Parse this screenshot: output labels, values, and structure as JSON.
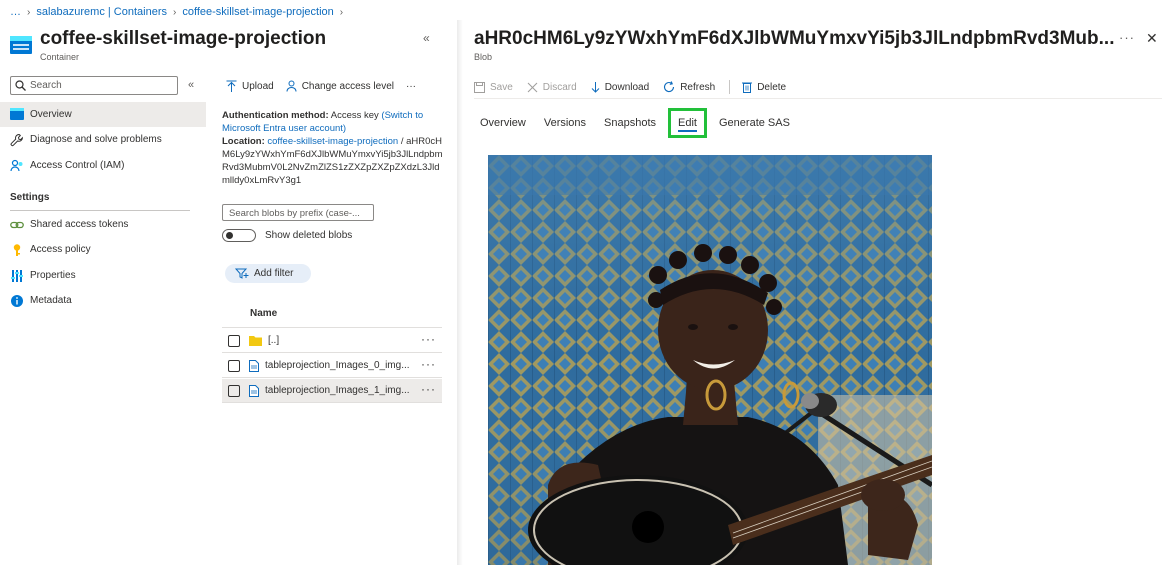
{
  "breadcrumb": {
    "ellipsis": "…",
    "items": [
      "salabazuremc | Containers",
      "coffee-skillset-image-projection"
    ]
  },
  "container": {
    "title": "coffee-skillset-image-projection",
    "subtitle": "Container"
  },
  "search": {
    "placeholder": "Search"
  },
  "nav": {
    "items": [
      {
        "label": "Overview",
        "icon": "container-icon",
        "selected": true
      },
      {
        "label": "Diagnose and solve problems",
        "icon": "wrench-icon"
      },
      {
        "label": "Access Control (IAM)",
        "icon": "people-icon"
      }
    ],
    "settings_heading": "Settings",
    "settings_items": [
      {
        "label": "Shared access tokens",
        "icon": "link-icon"
      },
      {
        "label": "Access policy",
        "icon": "key-icon"
      },
      {
        "label": "Properties",
        "icon": "properties-icon"
      },
      {
        "label": "Metadata",
        "icon": "info-icon"
      }
    ]
  },
  "middle": {
    "toolbar": {
      "upload": "Upload",
      "change_access": "Change access level",
      "more": "···"
    },
    "auth_label": "Authentication method:",
    "auth_value": "Access key",
    "auth_switch": "(Switch to Microsoft Entra user account)",
    "location_label": "Location:",
    "location_link": "coffee-skillset-image-projection",
    "location_sep": "/",
    "location_path": "aHR0cHM6Ly9zYWxhYmF6dXJlbWMuYmxvYi5jb3JlLndpbmRvd3MubmV0L2NvZmZlZS1zZXZpZXZpZXdzL3Jldmlldy0xLmRvY3g1",
    "prefix_placeholder": "Search blobs by prefix (case-...",
    "show_deleted": "Show deleted blobs",
    "show_deleted_on": false,
    "add_filter": "Add filter",
    "column_name": "Name",
    "rows": [
      {
        "name": "[..]",
        "type": "folder"
      },
      {
        "name": "tableprojection_Images_0_img...",
        "type": "file"
      },
      {
        "name": "tableprojection_Images_1_img...",
        "type": "file"
      }
    ],
    "row_more": "···"
  },
  "blade": {
    "title": "aHR0cHM6Ly9zYWxhYmF6dXJlbWMuYmxvYi5jb3JlLndpbmRvd3Mub...",
    "subtitle": "Blob",
    "more": "···",
    "close": "✕",
    "commands": {
      "save": "Save",
      "discard": "Discard",
      "download": "Download",
      "refresh": "Refresh",
      "delete": "Delete"
    },
    "tabs": [
      "Overview",
      "Versions",
      "Snapshots",
      "Edit",
      "Generate SAS"
    ],
    "active_tab": "Edit"
  },
  "colors": {
    "accent": "#0f6cbd",
    "highlight_box": "#22c03a",
    "selected_bg": "#edebe9"
  }
}
